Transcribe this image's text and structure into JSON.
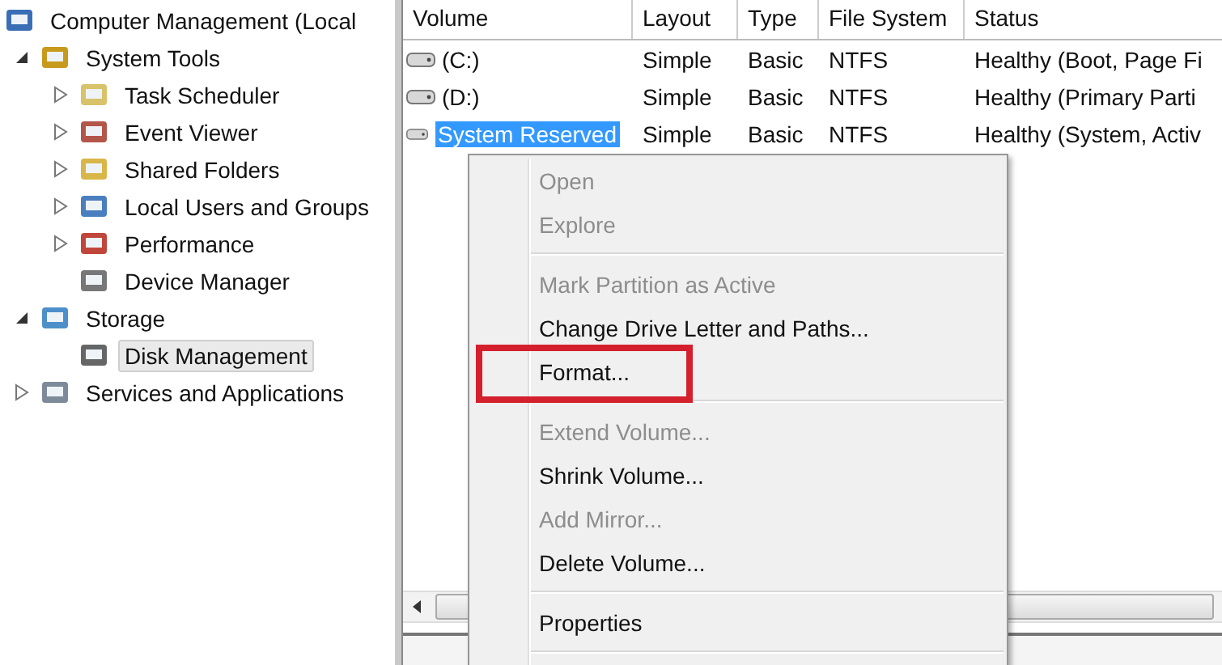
{
  "tree": [
    {
      "label": "Computer Management (Local",
      "selected": false,
      "children": [
        {
          "label": "System Tools",
          "expanded": true,
          "selected": false,
          "children": [
            {
              "label": "Task Scheduler",
              "expanded": false,
              "selected": false
            },
            {
              "label": "Event Viewer",
              "expanded": false,
              "selected": false
            },
            {
              "label": "Shared Folders",
              "expanded": false,
              "selected": false
            },
            {
              "label": "Local Users and Groups",
              "expanded": false,
              "selected": false
            },
            {
              "label": "Performance",
              "expanded": false,
              "selected": false
            },
            {
              "label": "Device Manager",
              "selected": false
            }
          ]
        },
        {
          "label": "Storage",
          "expanded": true,
          "selected": false,
          "children": [
            {
              "label": "Disk Management",
              "selected": true
            }
          ]
        },
        {
          "label": "Services and Applications",
          "expanded": false,
          "selected": false
        }
      ]
    }
  ],
  "table": {
    "columns": [
      "Volume",
      "Layout",
      "Type",
      "File System",
      "Status"
    ],
    "rows": [
      {
        "cells": [
          "(C:)",
          "Simple",
          "Basic",
          "NTFS",
          "Healthy (Boot, Page Fi"
        ],
        "selected": false
      },
      {
        "cells": [
          "(D:)",
          "Simple",
          "Basic",
          "NTFS",
          "Healthy (Primary Parti"
        ],
        "selected": false
      },
      {
        "cells": [
          "System Reserved",
          "Simple",
          "Basic",
          "NTFS",
          "Healthy (System, Activ"
        ],
        "selected": true
      }
    ]
  },
  "context_menu": {
    "items": [
      {
        "kind": "item",
        "label": "Open",
        "disabled": true,
        "annotated": false
      },
      {
        "kind": "item",
        "label": "Explore",
        "disabled": true,
        "annotated": false
      },
      {
        "kind": "separator"
      },
      {
        "kind": "item",
        "label": "Mark Partition as Active",
        "disabled": true,
        "annotated": false
      },
      {
        "kind": "item",
        "label": "Change Drive Letter and Paths...",
        "disabled": false,
        "annotated": false
      },
      {
        "kind": "item",
        "label": "Format...",
        "disabled": false,
        "annotated": true
      },
      {
        "kind": "separator"
      },
      {
        "kind": "item",
        "label": "Extend Volume...",
        "disabled": true,
        "annotated": false
      },
      {
        "kind": "item",
        "label": "Shrink Volume...",
        "disabled": false,
        "annotated": false
      },
      {
        "kind": "item",
        "label": "Add Mirror...",
        "disabled": true,
        "annotated": false
      },
      {
        "kind": "item",
        "label": "Delete Volume...",
        "disabled": false,
        "annotated": false
      },
      {
        "kind": "separator"
      },
      {
        "kind": "item",
        "label": "Properties",
        "disabled": false,
        "annotated": false
      },
      {
        "kind": "separator"
      }
    ]
  }
}
